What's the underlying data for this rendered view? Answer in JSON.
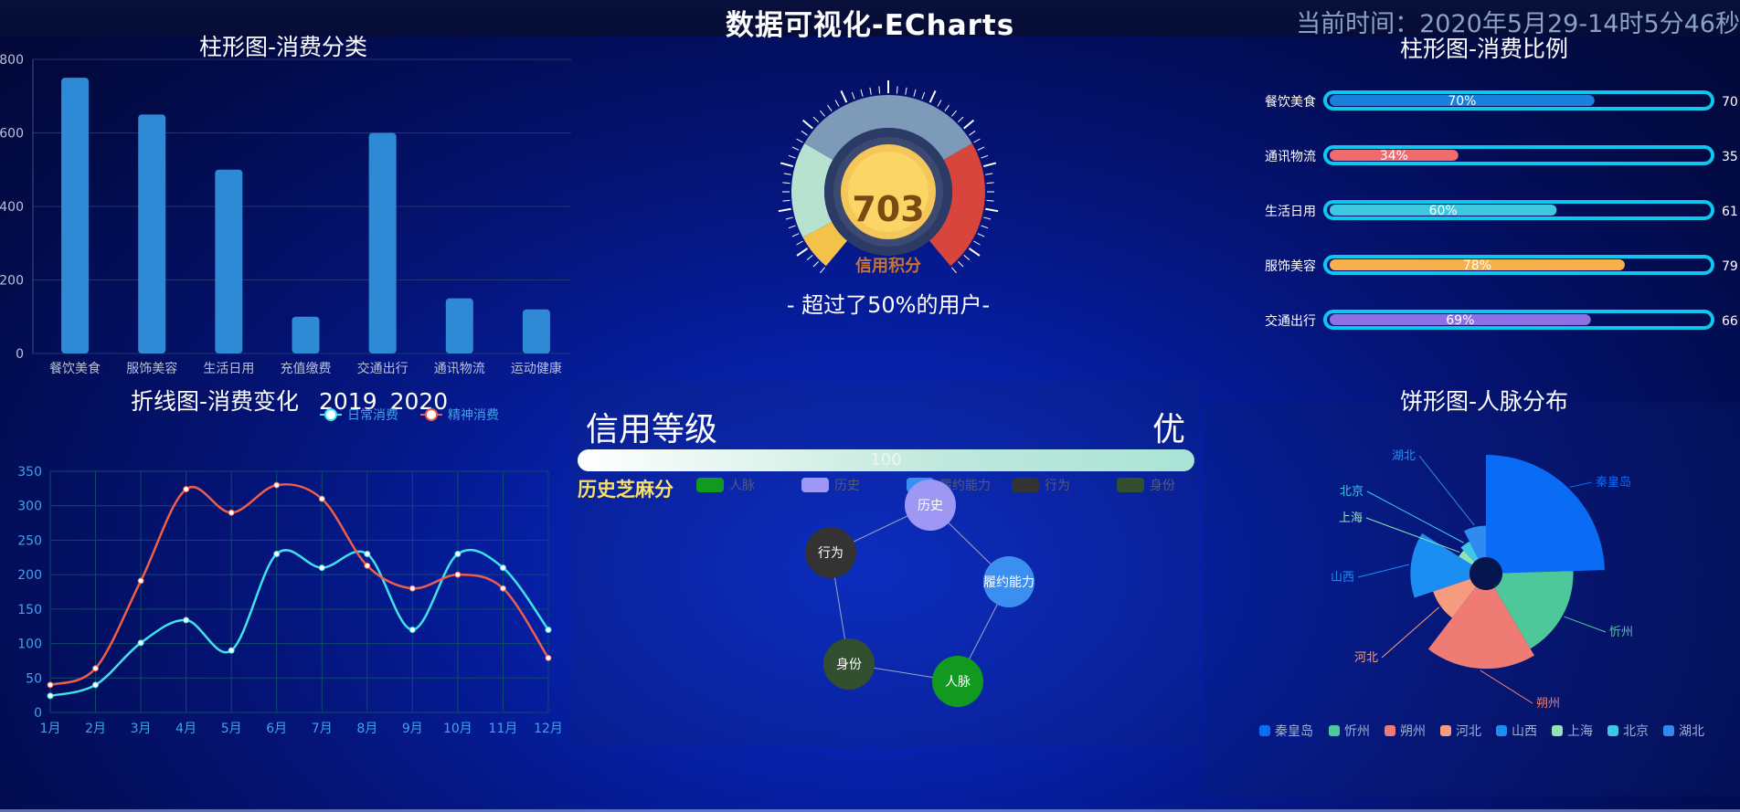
{
  "header": {
    "title": "数据可视化-ECharts",
    "time_text": "当前时间：2020年5月29-14时5分46秒"
  },
  "bar_panel": {
    "title": "柱形图-消费分类"
  },
  "gauge_panel": {
    "value": "703",
    "label": "信用积分",
    "subtitle": "- 超过了50%的用户-"
  },
  "progress_panel": {
    "title": "柱形图-消费比例"
  },
  "line_panel": {
    "title": "折线图-消费变化",
    "year_2019": "2019",
    "year_2020": "2020"
  },
  "credit_panel": {
    "level_label": "信用等级",
    "level_value": "优",
    "bar_value_label": "100",
    "graph_title": "历史芝麻分",
    "legend": [
      "人脉",
      "历史",
      "履约能力",
      "行为",
      "身份"
    ],
    "nodes": [
      "历史",
      "履约能力",
      "人脉",
      "身份",
      "行为"
    ]
  },
  "pie_panel": {
    "title": "饼形图-人脉分布"
  },
  "colors": {
    "bar_blue": "#2f8ad6",
    "line_cyan": "#3ee3ee",
    "line_red": "#ee5e4a",
    "progress_border": "#0fc6ee"
  },
  "chart_data": [
    {
      "type": "bar",
      "title": "柱形图-消费分类",
      "categories": [
        "餐饮美食",
        "服饰美容",
        "生活日用",
        "充值缴费",
        "交通出行",
        "通讯物流",
        "运动健康"
      ],
      "values": [
        750,
        650,
        500,
        100,
        600,
        150,
        120
      ],
      "y_ticks": [
        "0",
        "200",
        "400",
        "600",
        "800"
      ],
      "ylim": [
        0,
        800
      ],
      "grid": true
    },
    {
      "type": "bar",
      "title": "柱形图-消费比例",
      "orientation": "horizontal",
      "categories": [
        "餐饮美食",
        "通讯物流",
        "生活日用",
        "服饰美容",
        "交通出行"
      ],
      "values": [
        70,
        34,
        60,
        78,
        69
      ],
      "value_labels": [
        "70%",
        "34%",
        "60%",
        "78%",
        "69%"
      ],
      "right_labels": [
        "70",
        "35",
        "61",
        "79",
        "66"
      ],
      "bar_colors": [
        "#1a7fdd",
        "#ef6b6e",
        "#3ec8e0",
        "#f7b04a",
        "#8f6fe6"
      ]
    },
    {
      "type": "line",
      "title": "折线图-消费变化",
      "categories": [
        "1月",
        "2月",
        "3月",
        "4月",
        "5月",
        "6月",
        "7月",
        "8月",
        "9月",
        "10月",
        "11月",
        "12月"
      ],
      "y_ticks": [
        "0",
        "50",
        "100",
        "150",
        "200",
        "250",
        "300",
        "350"
      ],
      "ylim": [
        0,
        350
      ],
      "series": [
        {
          "name": "日常消费",
          "color": "#3ee3ee",
          "values": [
            24,
            40,
            101,
            134,
            90,
            230,
            210,
            230,
            120,
            230,
            210,
            120
          ]
        },
        {
          "name": "精神消费",
          "color": "#ee5e4a",
          "values": [
            40,
            64,
            191,
            324,
            290,
            330,
            310,
            213,
            180,
            200,
            180,
            79
          ]
        }
      ],
      "legend_position": "top-right"
    },
    {
      "type": "pie",
      "subtype": "rose",
      "title": "饼形图-人脉分布",
      "categories": [
        "秦皇岛",
        "忻州",
        "朔州",
        "河北",
        "山西",
        "上海",
        "北京",
        "湖北"
      ],
      "values": [
        130,
        90,
        100,
        50,
        75,
        20,
        25,
        40
      ],
      "colors": [
        "#0a6cf5",
        "#4ec89a",
        "#ef7c74",
        "#f79b7e",
        "#1b8ef2",
        "#8fe3b5",
        "#3ec8e8",
        "#2f8bf0"
      ],
      "legend_position": "bottom"
    },
    {
      "type": "gauge",
      "value": 703,
      "label": "信用积分"
    }
  ]
}
